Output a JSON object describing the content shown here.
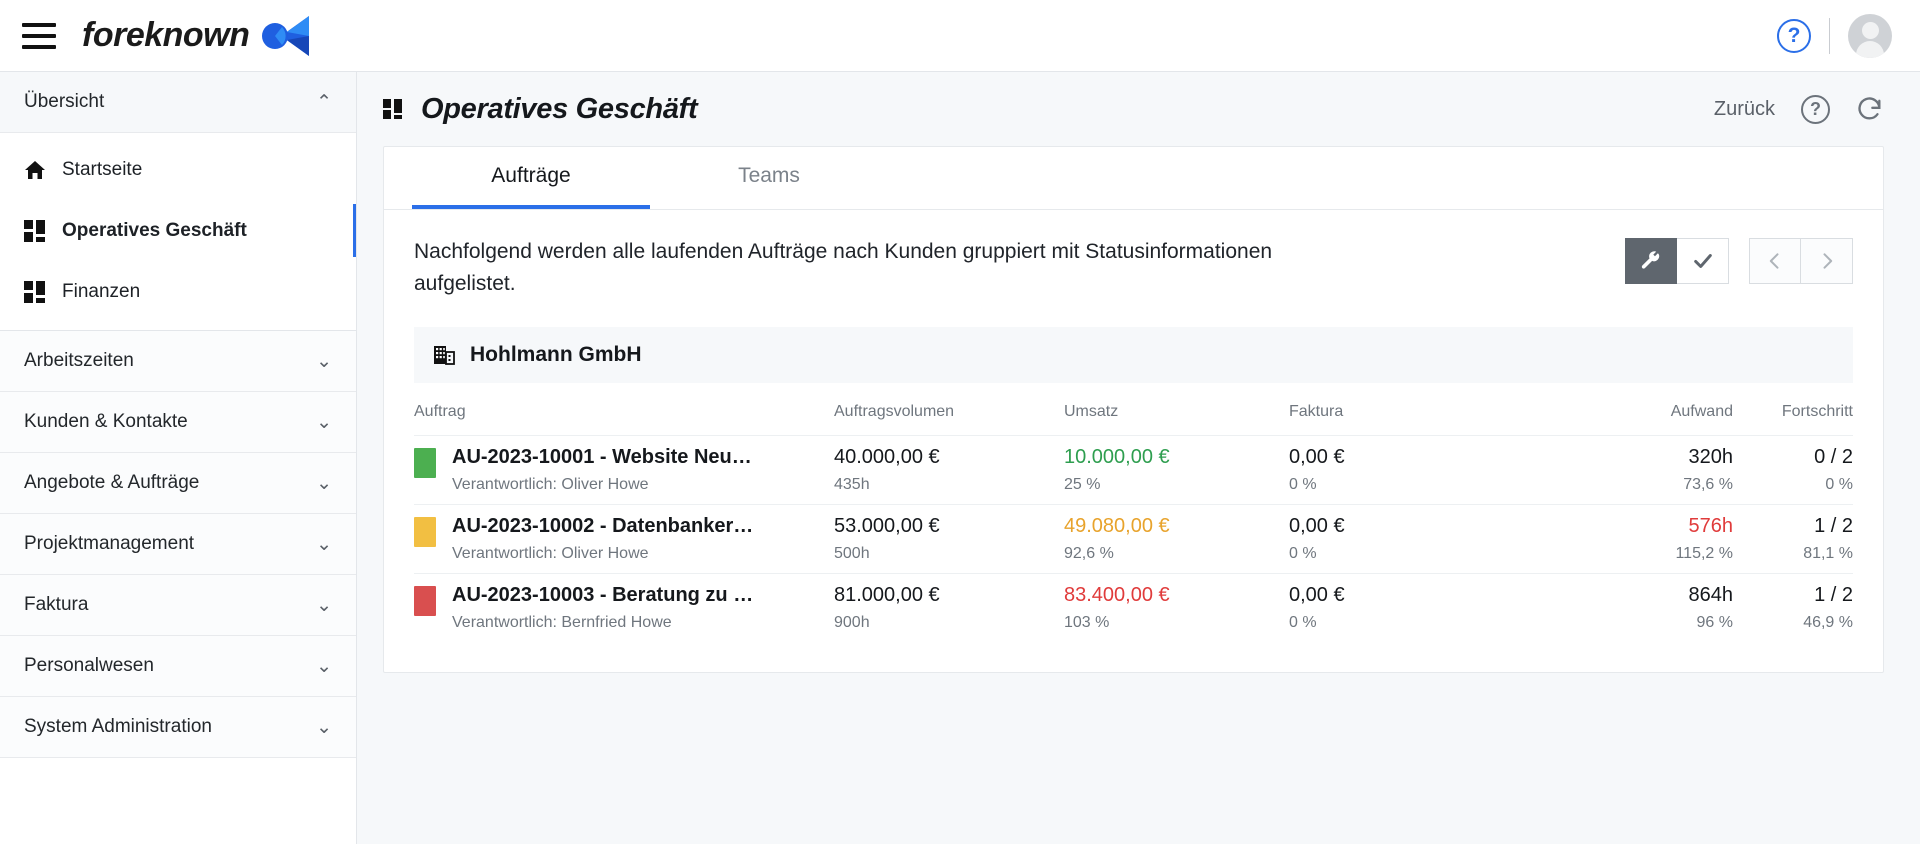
{
  "topbar": {
    "menu_icon": "hamburger-icon",
    "brand_name": "foreknown",
    "help_icon": "help-circle-icon",
    "help_glyph": "?",
    "avatar_icon": "user-avatar"
  },
  "sidebar": {
    "groups": [
      {
        "label": "Übersicht",
        "expanded": true,
        "chevron": "chevron-up-icon",
        "items": [
          {
            "label": "Startseite",
            "icon": "home-icon",
            "active": false
          },
          {
            "label": "Operatives Geschäft",
            "icon": "dashboard-icon",
            "active": true
          },
          {
            "label": "Finanzen",
            "icon": "dashboard-icon",
            "active": false
          }
        ]
      },
      {
        "label": "Arbeitszeiten",
        "expanded": false,
        "chevron": "chevron-down-icon",
        "items": []
      },
      {
        "label": "Kunden & Kontakte",
        "expanded": false,
        "chevron": "chevron-down-icon",
        "items": []
      },
      {
        "label": "Angebote & Aufträge",
        "expanded": false,
        "chevron": "chevron-down-icon",
        "items": []
      },
      {
        "label": "Projektmanagement",
        "expanded": false,
        "chevron": "chevron-down-icon",
        "items": []
      },
      {
        "label": "Faktura",
        "expanded": false,
        "chevron": "chevron-down-icon",
        "items": []
      },
      {
        "label": "Personalwesen",
        "expanded": false,
        "chevron": "chevron-down-icon",
        "items": []
      },
      {
        "label": "System Administration",
        "expanded": false,
        "chevron": "chevron-down-icon",
        "items": []
      }
    ]
  },
  "page": {
    "title": "Operatives Geschäft",
    "title_icon": "dashboard-icon",
    "back_label": "Zurück",
    "help_icon": "help-circle-icon",
    "help_glyph": "?",
    "refresh_icon": "refresh-icon"
  },
  "tabs": [
    {
      "label": "Aufträge",
      "active": true
    },
    {
      "label": "Teams",
      "active": false
    }
  ],
  "content": {
    "description": "Nachfolgend werden alle laufenden Aufträge nach Kunden gruppiert mit Statusinformationen aufgelistet.",
    "toolbar": {
      "settings_icon": "wrench-icon",
      "settings_glyph": "🔧",
      "confirm_icon": "check-icon",
      "confirm_glyph": "✔",
      "prev_icon": "chevron-left-icon",
      "prev_glyph": "‹",
      "next_icon": "chevron-right-icon",
      "next_glyph": "›"
    },
    "group": {
      "icon": "building-icon",
      "name": "Hohlmann GmbH"
    },
    "columns": [
      "Auftrag",
      "Auftragsvolumen",
      "Umsatz",
      "Faktura",
      "Aufwand",
      "Fortschritt"
    ],
    "rows": [
      {
        "status_color": "#4caf50",
        "title": "AU-2023-10001 - Website Neu…",
        "owner": "Verantwortlich: Oliver Howe",
        "volume": "40.000,00 €",
        "volume_sub": "435h",
        "revenue": "10.000,00 €",
        "revenue_color": "green",
        "revenue_sub": "25 %",
        "invoice": "0,00 €",
        "invoice_sub": "0 %",
        "effort": "320h",
        "effort_color": "",
        "effort_sub": "73,6 %",
        "progress": "0 / 2",
        "progress_sub": "0 %"
      },
      {
        "status_color": "#f2bf42",
        "title": "AU-2023-10002 - Datenbanker…",
        "owner": "Verantwortlich: Oliver Howe",
        "volume": "53.000,00 €",
        "volume_sub": "500h",
        "revenue": "49.080,00 €",
        "revenue_color": "amber",
        "revenue_sub": "92,6 %",
        "invoice": "0,00 €",
        "invoice_sub": "0 %",
        "effort": "576h",
        "effort_color": "red",
        "effort_sub": "115,2 %",
        "progress": "1 / 2",
        "progress_sub": "81,1 %"
      },
      {
        "status_color": "#d94f4f",
        "title": "AU-2023-10003 - Beratung zu …",
        "owner": "Verantwortlich: Bernfried Howe",
        "volume": "81.000,00 €",
        "volume_sub": "900h",
        "revenue": "83.400,00 €",
        "revenue_color": "red",
        "revenue_sub": "103 %",
        "invoice": "0,00 €",
        "invoice_sub": "0 %",
        "effort": "864h",
        "effort_color": "",
        "effort_sub": "96 %",
        "progress": "1 / 2",
        "progress_sub": "46,9 %"
      }
    ]
  },
  "colors": {
    "accent": "#2b6fe8",
    "green": "#2e9e4f",
    "amber": "#e8a32c",
    "red": "#e03b3b"
  }
}
